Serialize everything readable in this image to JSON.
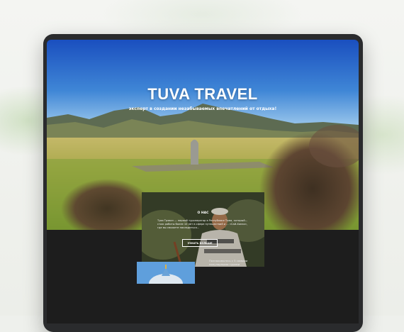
{
  "hero": {
    "title": "TUVA TRAVEL",
    "subtitle": "эксперт в создании незабываемых впечатлений от отдыха!"
  },
  "about": {
    "heading": "О НАС",
    "text": "Тува Трэвел — первый туроператор в Республике Тыва, который... стаж работы более 10 лет в сфере путешествий и ... «Сай-Хонах», где вы сможете насладиться...",
    "button_label": "УЗНАТЬ БОЛЬШЕ"
  },
  "tours": {
    "caption": "Познакомьтесь с 5 самыми популярными турами"
  },
  "colors": {
    "sky_top": "#1f57c4",
    "sky_bottom": "#8ec1ea",
    "grass": "#9aa53a",
    "dark_bg": "#1d1d1d",
    "device_frame": "#2a2b2d"
  }
}
